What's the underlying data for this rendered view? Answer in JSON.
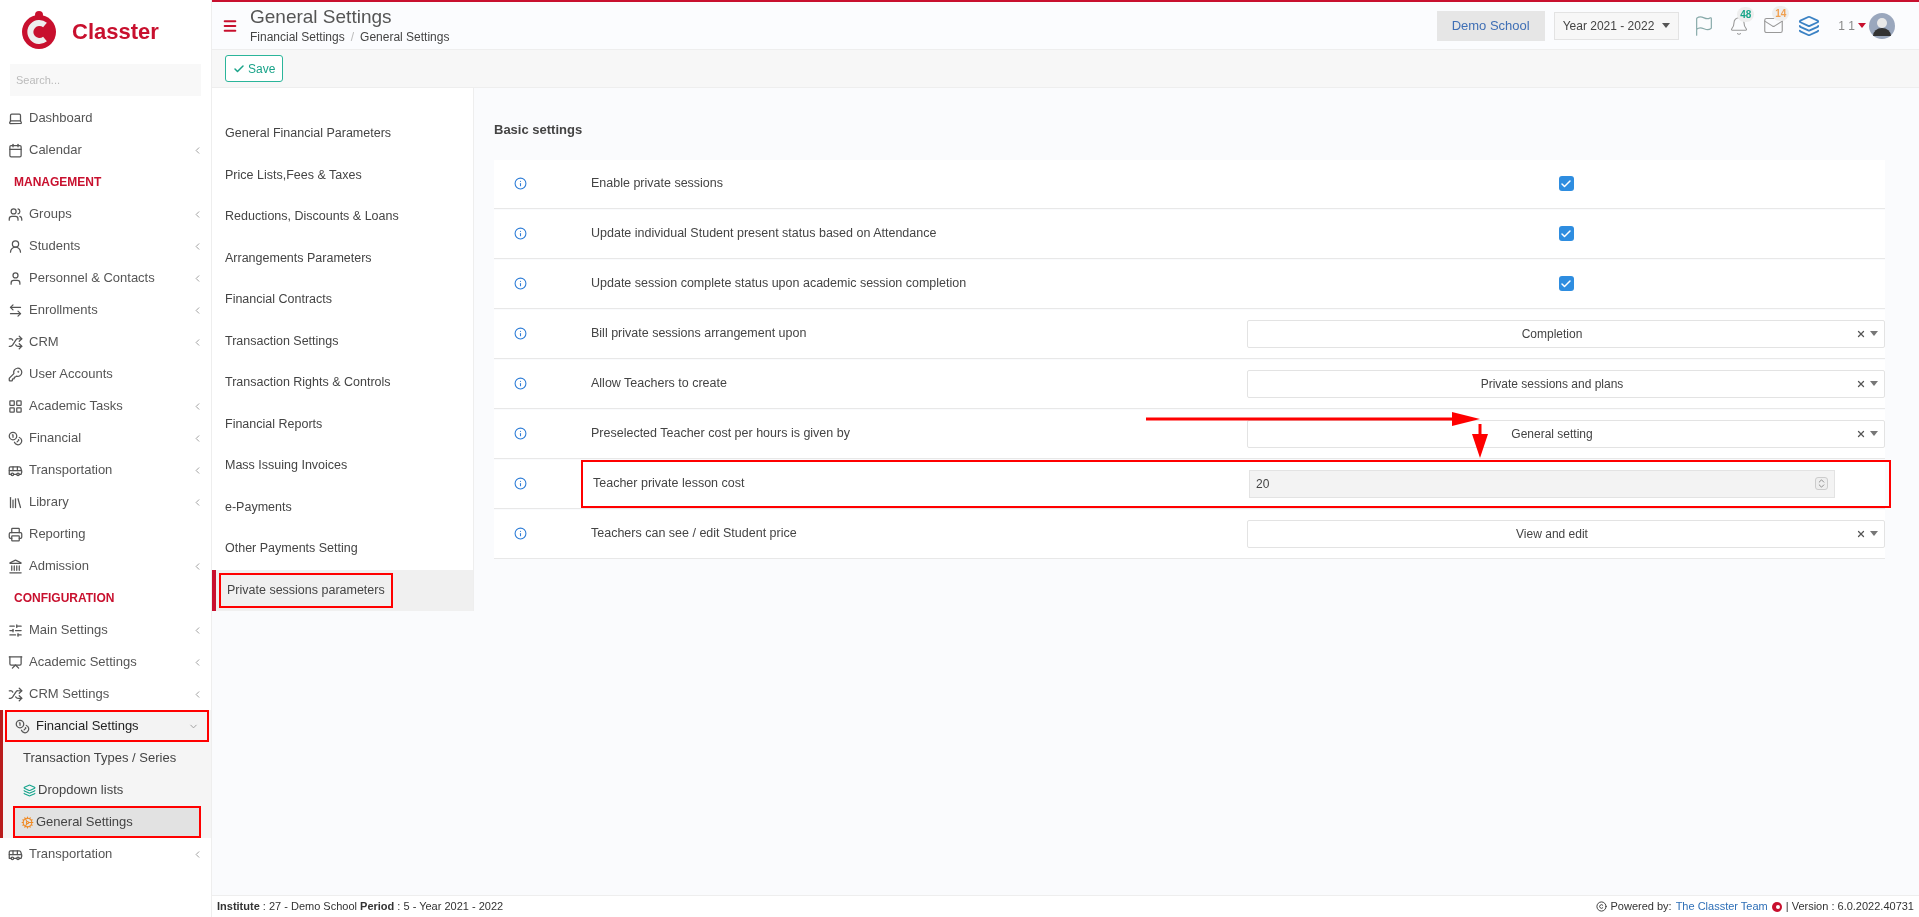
{
  "sidebar": {
    "brand": "Classter",
    "search": {
      "placeholder": "Search..."
    },
    "items": [
      {
        "kind": "item",
        "label": "Dashboard",
        "expandable": false
      },
      {
        "kind": "item",
        "label": "Calendar",
        "expandable": true
      },
      {
        "kind": "section",
        "label": "MANAGEMENT"
      },
      {
        "kind": "item",
        "label": "Groups",
        "expandable": true
      },
      {
        "kind": "item",
        "label": "Students",
        "expandable": true
      },
      {
        "kind": "item",
        "label": "Personnel & Contacts",
        "expandable": true
      },
      {
        "kind": "item",
        "label": "Enrollments",
        "expandable": true
      },
      {
        "kind": "item",
        "label": "CRM",
        "expandable": true
      },
      {
        "kind": "item",
        "label": "User Accounts",
        "expandable": false
      },
      {
        "kind": "item",
        "label": "Academic Tasks",
        "expandable": true
      },
      {
        "kind": "item",
        "label": "Financial",
        "expandable": true
      },
      {
        "kind": "item",
        "label": "Transportation",
        "expandable": true
      },
      {
        "kind": "item",
        "label": "Library",
        "expandable": true
      },
      {
        "kind": "item",
        "label": "Reporting",
        "expandable": false
      },
      {
        "kind": "item",
        "label": "Admission",
        "expandable": true
      },
      {
        "kind": "section",
        "label": "CONFIGURATION"
      },
      {
        "kind": "item",
        "label": "Main Settings",
        "expandable": true
      },
      {
        "kind": "item",
        "label": "Academic Settings",
        "expandable": true
      },
      {
        "kind": "item",
        "label": "CRM Settings",
        "expandable": true
      },
      {
        "kind": "item",
        "label": "Financial Settings",
        "expandable": true,
        "expanded": true,
        "highlighted": true,
        "children": [
          {
            "label": "Transaction Types / Series",
            "selected": false,
            "highlighted": false
          },
          {
            "label": "Dropdown lists",
            "selected": false,
            "highlighted": false
          },
          {
            "label": "General Settings",
            "selected": true,
            "highlighted": true
          }
        ]
      },
      {
        "kind": "item",
        "label": "Transportation",
        "expandable": true
      }
    ]
  },
  "header": {
    "title": "General Settings",
    "breadcrumb": [
      "Financial Settings",
      "General Settings"
    ],
    "breadcrumb_separator": "/",
    "school": "Demo School",
    "year": "Year 2021 - 2022",
    "notifications": "48",
    "messages": "14",
    "user": "1 1"
  },
  "toolbar": {
    "save": "Save"
  },
  "settings_menu": [
    {
      "label": "General Financial Parameters",
      "selected": false,
      "highlighted": false
    },
    {
      "label": "Price Lists,Fees & Taxes",
      "selected": false,
      "highlighted": false
    },
    {
      "label": "Reductions, Discounts & Loans",
      "selected": false,
      "highlighted": false
    },
    {
      "label": "Arrangements Parameters",
      "selected": false,
      "highlighted": false
    },
    {
      "label": "Financial Contracts",
      "selected": false,
      "highlighted": false
    },
    {
      "label": "Transaction Settings",
      "selected": false,
      "highlighted": false
    },
    {
      "label": "Transaction Rights & Controls",
      "selected": false,
      "highlighted": false
    },
    {
      "label": "Financial Reports",
      "selected": false,
      "highlighted": false
    },
    {
      "label": "Mass Issuing Invoices",
      "selected": false,
      "highlighted": false
    },
    {
      "label": "e-Payments",
      "selected": false,
      "highlighted": false
    },
    {
      "label": "Other Payments Setting",
      "selected": false,
      "highlighted": false
    },
    {
      "label": "Private sessions parameters",
      "selected": true,
      "highlighted": true
    }
  ],
  "basic_settings": {
    "title": "Basic settings",
    "rows": [
      {
        "kind": "checkbox",
        "label": "Enable private sessions",
        "checked": true,
        "highlighted": false
      },
      {
        "kind": "checkbox",
        "label": "Update individual Student present status based on Attendance",
        "checked": true,
        "highlighted": false
      },
      {
        "kind": "checkbox",
        "label": "Update session complete status upon academic session completion",
        "checked": true,
        "highlighted": false
      },
      {
        "kind": "select",
        "label": "Bill private sessions arrangement upon",
        "value": "Completion",
        "highlighted": false
      },
      {
        "kind": "select",
        "label": "Allow Teachers to create",
        "value": "Private sessions and plans",
        "highlighted": false
      },
      {
        "kind": "select",
        "label": "Preselected Teacher cost per hours is given by",
        "value": "General setting",
        "highlighted": false
      },
      {
        "kind": "number",
        "label": "Teacher private lesson cost",
        "value": "20",
        "highlighted": true
      },
      {
        "kind": "select",
        "label": "Teachers can see / edit Student price",
        "value": "View and edit",
        "highlighted": false
      }
    ]
  },
  "footer": {
    "info": "**Institute** : 27 - Demo School **Period** : 5 - Year 2021 - 2022",
    "powered_by": "Powered by:",
    "team": "The Classter Team",
    "version": "| Version : 6.0.2022.40731"
  }
}
